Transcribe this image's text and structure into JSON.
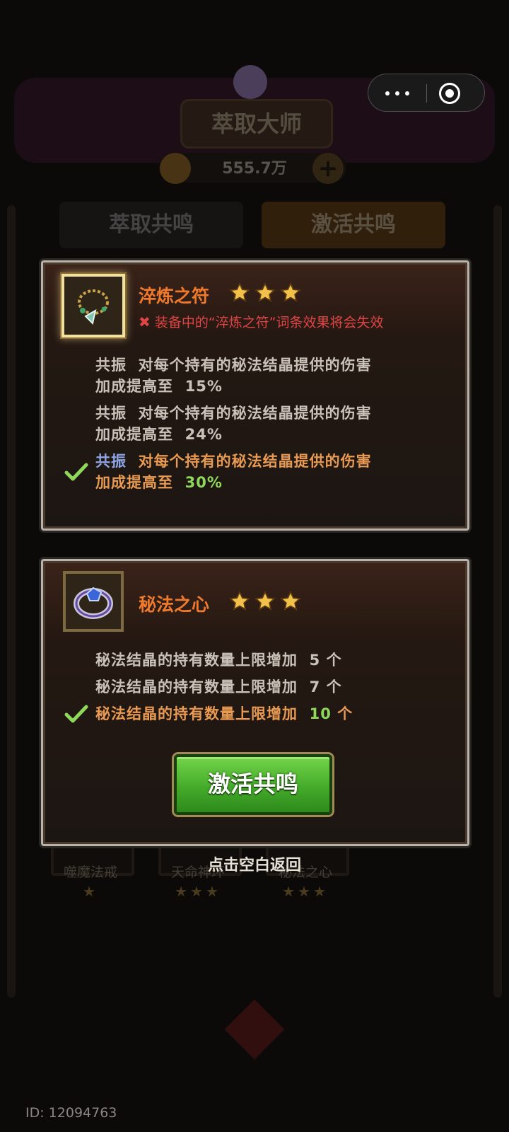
{
  "background": {
    "title": "萃取大师",
    "currency": "555.7万",
    "tabs": [
      "萃取共鸣",
      "激活共鸣"
    ],
    "slots": [
      {
        "name": "噬魔法戒",
        "stars": "★"
      },
      {
        "name": "天命神环",
        "stars": "★★★"
      },
      {
        "name": "秘法之心",
        "stars": "★★★"
      }
    ]
  },
  "panel1": {
    "item_name": "淬炼之符",
    "star_count": 3,
    "warning": "装备中的“淬炼之符”词条效果将会失效",
    "levels": [
      {
        "tag": "共振",
        "text1": "对每个持有的秘法结晶提供的伤害",
        "text2": "加成提高至",
        "value": "15%",
        "active": false
      },
      {
        "tag": "共振",
        "text1": "对每个持有的秘法结晶提供的伤害",
        "text2": "加成提高至",
        "value": "24%",
        "active": false
      },
      {
        "tag": "共振",
        "text1": "对每个持有的秘法结晶提供的伤害",
        "text2": "加成提高至",
        "value": "30%",
        "active": true
      }
    ]
  },
  "panel2": {
    "item_name": "秘法之心",
    "star_count": 3,
    "levels": [
      {
        "text": "秘法结晶的持有数量上限增加",
        "value": "5",
        "unit": "个",
        "active": false
      },
      {
        "text": "秘法结晶的持有数量上限增加",
        "value": "7",
        "unit": "个",
        "active": false
      },
      {
        "text": "秘法结晶的持有数量上限增加",
        "value": "10",
        "unit": "个",
        "active": true
      }
    ],
    "button_label": "激活共鸣"
  },
  "tap_back_label": "点击空白返回",
  "user_id": "ID: 12094763",
  "colors": {
    "title_orange": "#f07a2c",
    "warning_red": "#e04545",
    "active_green": "#8ed85a",
    "active_tag_blue": "#8fa6e6",
    "button_green": "#44ab2a"
  },
  "icons": [
    "more-dots-icon",
    "close-target-icon",
    "amulet-beads-icon",
    "arcane-ring-icon",
    "star-icon",
    "check-icon",
    "cross-mark-icon"
  ]
}
